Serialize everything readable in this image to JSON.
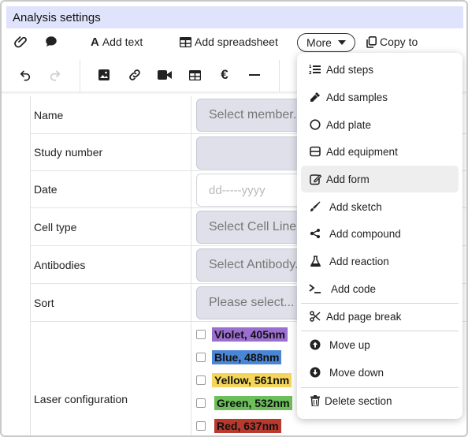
{
  "window": {
    "title": "Analysis settings"
  },
  "toolbar": {
    "add_text": "Add text",
    "add_spreadsheet": "Add spreadsheet",
    "more": "More",
    "copy_to": "Copy to"
  },
  "form": {
    "rows": [
      {
        "label": "Name",
        "placeholder": "Select member..."
      },
      {
        "label": "Study number",
        "placeholder": ""
      },
      {
        "label": "Date",
        "placeholder": "dd-----yyyy"
      },
      {
        "label": "Cell type",
        "placeholder": "Select Cell Line..."
      },
      {
        "label": "Antibodies",
        "placeholder": "Select Antibody..."
      },
      {
        "label": "Sort",
        "placeholder": "Please select..."
      }
    ],
    "laser": {
      "label": "Laser configuration",
      "options": [
        {
          "text": "Violet, 405nm",
          "color": "#9b6fcf"
        },
        {
          "text": "Blue, 488nm",
          "color": "#4a86d6"
        },
        {
          "text": "Yellow, 561nm",
          "color": "#f5d65a"
        },
        {
          "text": "Green, 532nm",
          "color": "#6cbf5b"
        },
        {
          "text": "Red, 637nm",
          "color": "#b83a2e"
        }
      ]
    }
  },
  "menu": {
    "items": [
      {
        "label": "Add steps",
        "icon": "list-numbered-icon"
      },
      {
        "label": "Add samples",
        "icon": "pipette-icon"
      },
      {
        "label": "Add plate",
        "icon": "circle-icon"
      },
      {
        "label": "Add equipment",
        "icon": "equipment-icon"
      },
      {
        "label": "Add form",
        "icon": "form-edit-icon"
      },
      {
        "label": "Add sketch",
        "icon": "brush-icon"
      },
      {
        "label": "Add compound",
        "icon": "molecule-icon"
      },
      {
        "label": "Add reaction",
        "icon": "flask-icon"
      },
      {
        "label": "Add code",
        "icon": "terminal-icon"
      },
      {
        "label": "Add page break",
        "icon": "scissors-icon"
      },
      {
        "label": "Move up",
        "icon": "arrow-up-circle-icon"
      },
      {
        "label": "Move down",
        "icon": "arrow-down-circle-icon"
      },
      {
        "label": "Delete section",
        "icon": "trash-icon"
      }
    ]
  }
}
